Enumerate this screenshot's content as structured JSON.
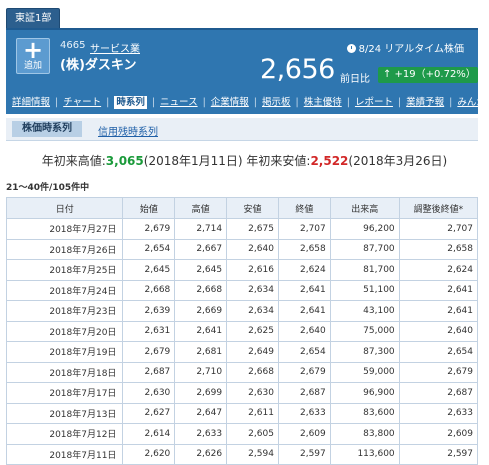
{
  "market_tab": "東証1部",
  "stock": {
    "code": "4665",
    "industry": "サービス業",
    "name": "(株)ダスキン",
    "add_label": "追加",
    "realtime": "8/24 リアルタイム株価",
    "price": "2,656",
    "prev_label": "前日比",
    "change": "↑ +19（+0.72%）"
  },
  "nav": [
    "詳細情報",
    "チャート",
    "時系列",
    "ニュース",
    "企業情報",
    "掲示板",
    "株主優待",
    "レポート",
    "業績予報",
    "みんかぶ"
  ],
  "nav_active_index": 2,
  "subtabs": {
    "active": "株価時系列",
    "other": "信用残時系列"
  },
  "ytd": {
    "high_label": "年初来高値:",
    "high_value": "3,065",
    "high_date": "(2018年1月11日)",
    "low_label": "年初来安値:",
    "low_value": "2,522",
    "low_date": "(2018年3月26日)"
  },
  "count_text": "21〜40件/105件中",
  "table": {
    "headers": [
      "日付",
      "始値",
      "高値",
      "安値",
      "終値",
      "出来高",
      "調整後終値*"
    ],
    "rows": [
      [
        "2018年7月27日",
        "2,679",
        "2,714",
        "2,675",
        "2,707",
        "96,200",
        "2,707"
      ],
      [
        "2018年7月26日",
        "2,654",
        "2,667",
        "2,640",
        "2,658",
        "87,700",
        "2,658"
      ],
      [
        "2018年7月25日",
        "2,645",
        "2,645",
        "2,616",
        "2,624",
        "81,700",
        "2,624"
      ],
      [
        "2018年7月24日",
        "2,668",
        "2,668",
        "2,634",
        "2,641",
        "51,100",
        "2,641"
      ],
      [
        "2018年7月23日",
        "2,639",
        "2,669",
        "2,634",
        "2,641",
        "43,100",
        "2,641"
      ],
      [
        "2018年7月20日",
        "2,631",
        "2,641",
        "2,625",
        "2,640",
        "75,000",
        "2,640"
      ],
      [
        "2018年7月19日",
        "2,679",
        "2,681",
        "2,649",
        "2,654",
        "87,300",
        "2,654"
      ],
      [
        "2018年7月18日",
        "2,687",
        "2,710",
        "2,668",
        "2,679",
        "59,000",
        "2,679"
      ],
      [
        "2018年7月17日",
        "2,630",
        "2,699",
        "2,630",
        "2,687",
        "96,900",
        "2,687"
      ],
      [
        "2018年7月13日",
        "2,627",
        "2,647",
        "2,611",
        "2,633",
        "83,600",
        "2,633"
      ],
      [
        "2018年7月12日",
        "2,614",
        "2,633",
        "2,605",
        "2,609",
        "83,800",
        "2,609"
      ],
      [
        "2018年7月11日",
        "2,620",
        "2,626",
        "2,594",
        "2,597",
        "113,600",
        "2,597"
      ]
    ]
  }
}
